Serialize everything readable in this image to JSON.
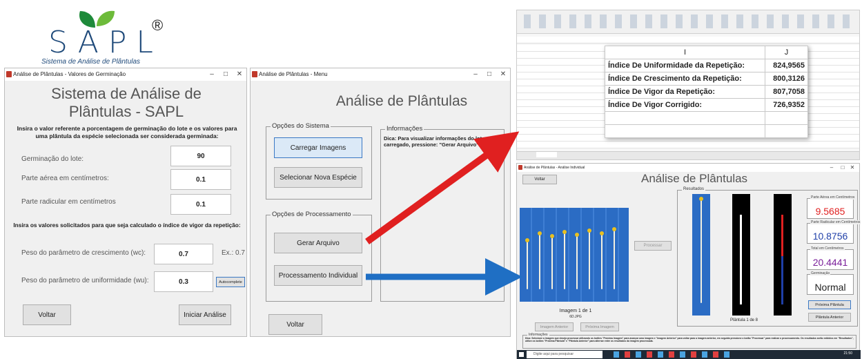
{
  "logo": {
    "word": "SAPL",
    "registered": "®",
    "tagline": "Sistema de Análise de Plântulas",
    "leaf_colors": [
      "#1e8a3a",
      "#6dbb3a"
    ],
    "brand_color": "#1f4a7a"
  },
  "germination_window": {
    "title": "Análise de Plântulas - Valores de Germinação",
    "heading": "Sistema de Análise de Plântulas - SAPL",
    "instruction1": "Insira o valor referente a porcentagem de germinação do lote e os valores para uma plântula da espécie selecionada ser considerada germinada:",
    "fields": [
      {
        "label": "Germinação do lote:",
        "value": "90"
      },
      {
        "label": "Parte aérea em centímetros:",
        "value": "0.1"
      },
      {
        "label": "Parte radicular em centímetros",
        "value": "0.1"
      }
    ],
    "instruction2": "Insira os valores solicitados para que seja calculado o índice de vigor da repetição:",
    "growth_label": "Peso do parâmetro de crescimento (wc):",
    "growth_value": "0.7",
    "growth_hint": "Ex.: 0.7",
    "uniformity_label": "Peso do parâmetro de uniformidade (wu):",
    "uniformity_value": "0.3",
    "autocomplete": "Autocomplete",
    "back": "Voltar",
    "start": "Iniciar Análise"
  },
  "menu_window": {
    "title": "Análise de Plântulas - Menu",
    "heading": "Análise de Plântulas",
    "system_group": "Opções do Sistema",
    "load_images": "Carregar Imagens",
    "select_species": "Selecionar Nova Espécie",
    "processing_group": "Opções de Processamento",
    "generate_file": "Gerar Arquivo",
    "individual": "Processamento Individual",
    "info_group": "Informações",
    "info_text": "Dica: Para visualizar informações do lote carregado, pressione: \"Gerar Arquivo\".",
    "back": "Voltar"
  },
  "spreadsheet": {
    "col_i": "I",
    "col_j": "J",
    "rows": [
      {
        "label": "Índice De Uniformidade da Repetição:",
        "value": "824,9565"
      },
      {
        "label": "Índice De Crescimento da Repetição:",
        "value": "800,3126"
      },
      {
        "label": "Índice De Vigor da Repetição:",
        "value": "807,7058"
      },
      {
        "label": "Índice De Vigor Corrigido:",
        "value": "726,9352"
      }
    ]
  },
  "individual_window": {
    "title": "Análise de Plântulas - Análise Individual",
    "back": "Voltar",
    "heading": "Análise de Plântulas",
    "results_group": "Resultados",
    "process": "Processar",
    "image_counter": "Imagem 1 de 1",
    "image_name": "6D.JPG",
    "prev_image": "Imagem Anterior",
    "next_image": "Próxima Imagem",
    "seedling_counter": "Plântula 1 de 8",
    "results": [
      {
        "title": "Parte Aérea em Centímetros",
        "value": "9.5685",
        "color": "#e02020"
      },
      {
        "title": "Parte Radicular em Centímetros",
        "value": "10.8756",
        "color": "#1f3fa8"
      },
      {
        "title": "Total em Centímetros",
        "value": "20.4441",
        "color": "#7a1f9a"
      },
      {
        "title": "Germinação",
        "value": "Normal",
        "color": "#222222"
      }
    ],
    "next_seedling": "Próxima Plântula",
    "prev_seedling": "Plântula Anterior",
    "info_group": "Informações",
    "info_text": "Dica: Selecione a imagem que deseja processar utilizando os botões \"Próxima Imagem\" para avançar uma imagem e \"Imagem Anterior\" para voltar para a imagem anterior, em seguida pressione o botão \"Processar\" para realizar o processamento. Os resultados serão exibidos em \"Resultados\", utilize os botões \"Próxima Plântula\" e \"Plântula Anterior\" para alternar entre os resultados da imagem processada.",
    "search_placeholder": "Digite aqui para pesquisar",
    "clock": "21:50"
  },
  "arrow_colors": {
    "red": "#e02020",
    "blue": "#1f6fc4"
  }
}
